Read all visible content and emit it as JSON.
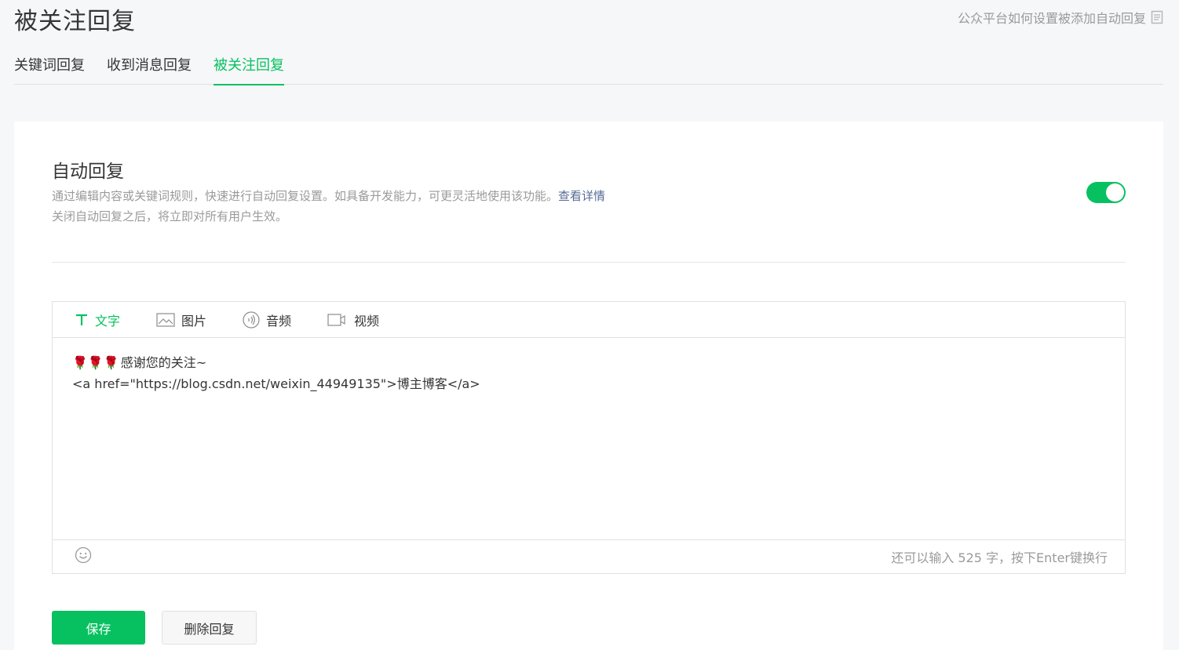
{
  "header": {
    "title": "被关注回复",
    "help_link": "公众平台如何设置被添加自动回复"
  },
  "tabs": [
    {
      "label": "关键词回复",
      "active": false
    },
    {
      "label": "收到消息回复",
      "active": false
    },
    {
      "label": "被关注回复",
      "active": true
    }
  ],
  "auto_reply": {
    "title": "自动回复",
    "desc_line1": "通过编辑内容或关键词规则，快速进行自动回复设置。如具备开发能力，可更灵活地使用该功能。",
    "desc_link": "查看详情",
    "desc_line2": "关闭自动回复之后，将立即对所有用户生效。",
    "enabled": true
  },
  "editor": {
    "toolbar": [
      {
        "label": "文字",
        "icon": "text-icon",
        "active": true
      },
      {
        "label": "图片",
        "icon": "image-icon",
        "active": false
      },
      {
        "label": "音频",
        "icon": "audio-icon",
        "active": false
      },
      {
        "label": "视频",
        "icon": "video-icon",
        "active": false
      }
    ],
    "content_roses": "🌹🌹🌹",
    "content_line1": "感谢您的关注~",
    "content_line2": "<a href=\"https://blog.csdn.net/weixin_44949135\">博主博客</a>",
    "counter": "还可以输入 525 字，按下Enter键换行"
  },
  "actions": {
    "save": "保存",
    "delete": "删除回复"
  },
  "colors": {
    "accent": "#07c160",
    "link": "#576b95",
    "muted": "#9a9a9a"
  }
}
